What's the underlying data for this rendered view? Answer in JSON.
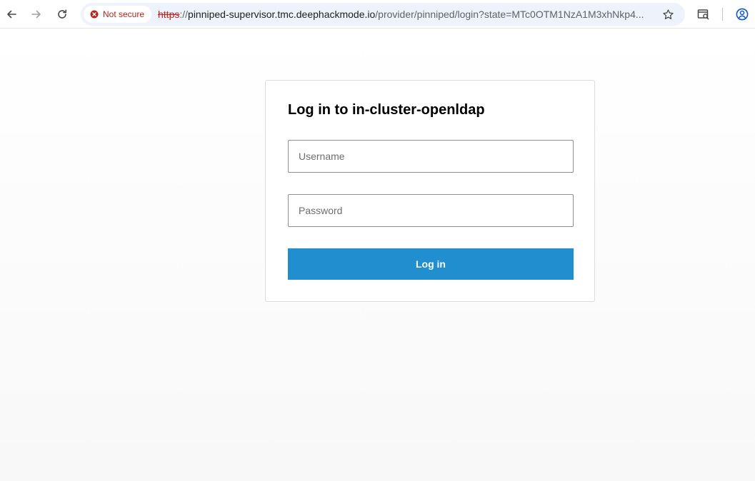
{
  "browser": {
    "security_chip": {
      "label": "Not secure",
      "icon": "warning-circle-icon",
      "color": "#b3261e"
    },
    "url": {
      "scheme": "https",
      "separator": "://",
      "host": "pinniped-supervisor.tmc.deephackmode.io",
      "path": "/provider/pinniped/login?state=MTc0OTM1NzA1M3xhNkp4..."
    },
    "icons": {
      "back": "arrow-left-icon",
      "forward": "arrow-right-icon",
      "reload": "reload-icon",
      "bookmark": "star-icon",
      "extension": "window-search-icon",
      "profile": "account-circle-icon"
    }
  },
  "login": {
    "title": "Log in to in-cluster-openldap",
    "username": {
      "value": "",
      "placeholder": "Username"
    },
    "password": {
      "value": "",
      "placeholder": "Password"
    },
    "submit_label": "Log in",
    "button_color": "#218fcf"
  }
}
